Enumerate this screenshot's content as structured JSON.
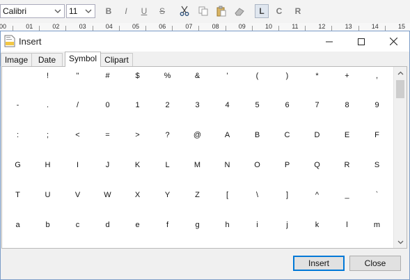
{
  "toolbar": {
    "font_name": "Calibri",
    "font_size": "11",
    "bold": "B",
    "italic": "I",
    "underline": "U",
    "strike": "S",
    "align_left": "L",
    "align_center": "C",
    "align_right": "R"
  },
  "ruler": [
    "00",
    "01",
    "02",
    "03",
    "04",
    "05",
    "06",
    "07",
    "08",
    "09",
    "10",
    "11",
    "12",
    "13",
    "14",
    "15"
  ],
  "dialog": {
    "title": "Insert",
    "tabs": [
      "Image",
      "Date",
      "Symbol",
      "Clipart"
    ],
    "selected_tab": "Symbol",
    "symbols": [
      [
        " ",
        "!",
        "\"",
        "#",
        "$",
        "%",
        "&",
        "'",
        "(",
        ")",
        "*",
        "+",
        ","
      ],
      [
        "-",
        ".",
        "/",
        "0",
        "1",
        "2",
        "3",
        "4",
        "5",
        "6",
        "7",
        "8",
        "9"
      ],
      [
        ":",
        ";",
        "<",
        "=",
        ">",
        "?",
        "@",
        "A",
        "B",
        "C",
        "D",
        "E",
        "F"
      ],
      [
        "G",
        "H",
        "I",
        "J",
        "K",
        "L",
        "M",
        "N",
        "O",
        "P",
        "Q",
        "R",
        "S"
      ],
      [
        "T",
        "U",
        "V",
        "W",
        "X",
        "Y",
        "Z",
        "[",
        "\\",
        "]",
        "^",
        "_",
        "`"
      ],
      [
        "a",
        "b",
        "c",
        "d",
        "e",
        "f",
        "g",
        "h",
        "i",
        "j",
        "k",
        "l",
        "m"
      ]
    ],
    "insert_label": "Insert",
    "close_label": "Close"
  }
}
